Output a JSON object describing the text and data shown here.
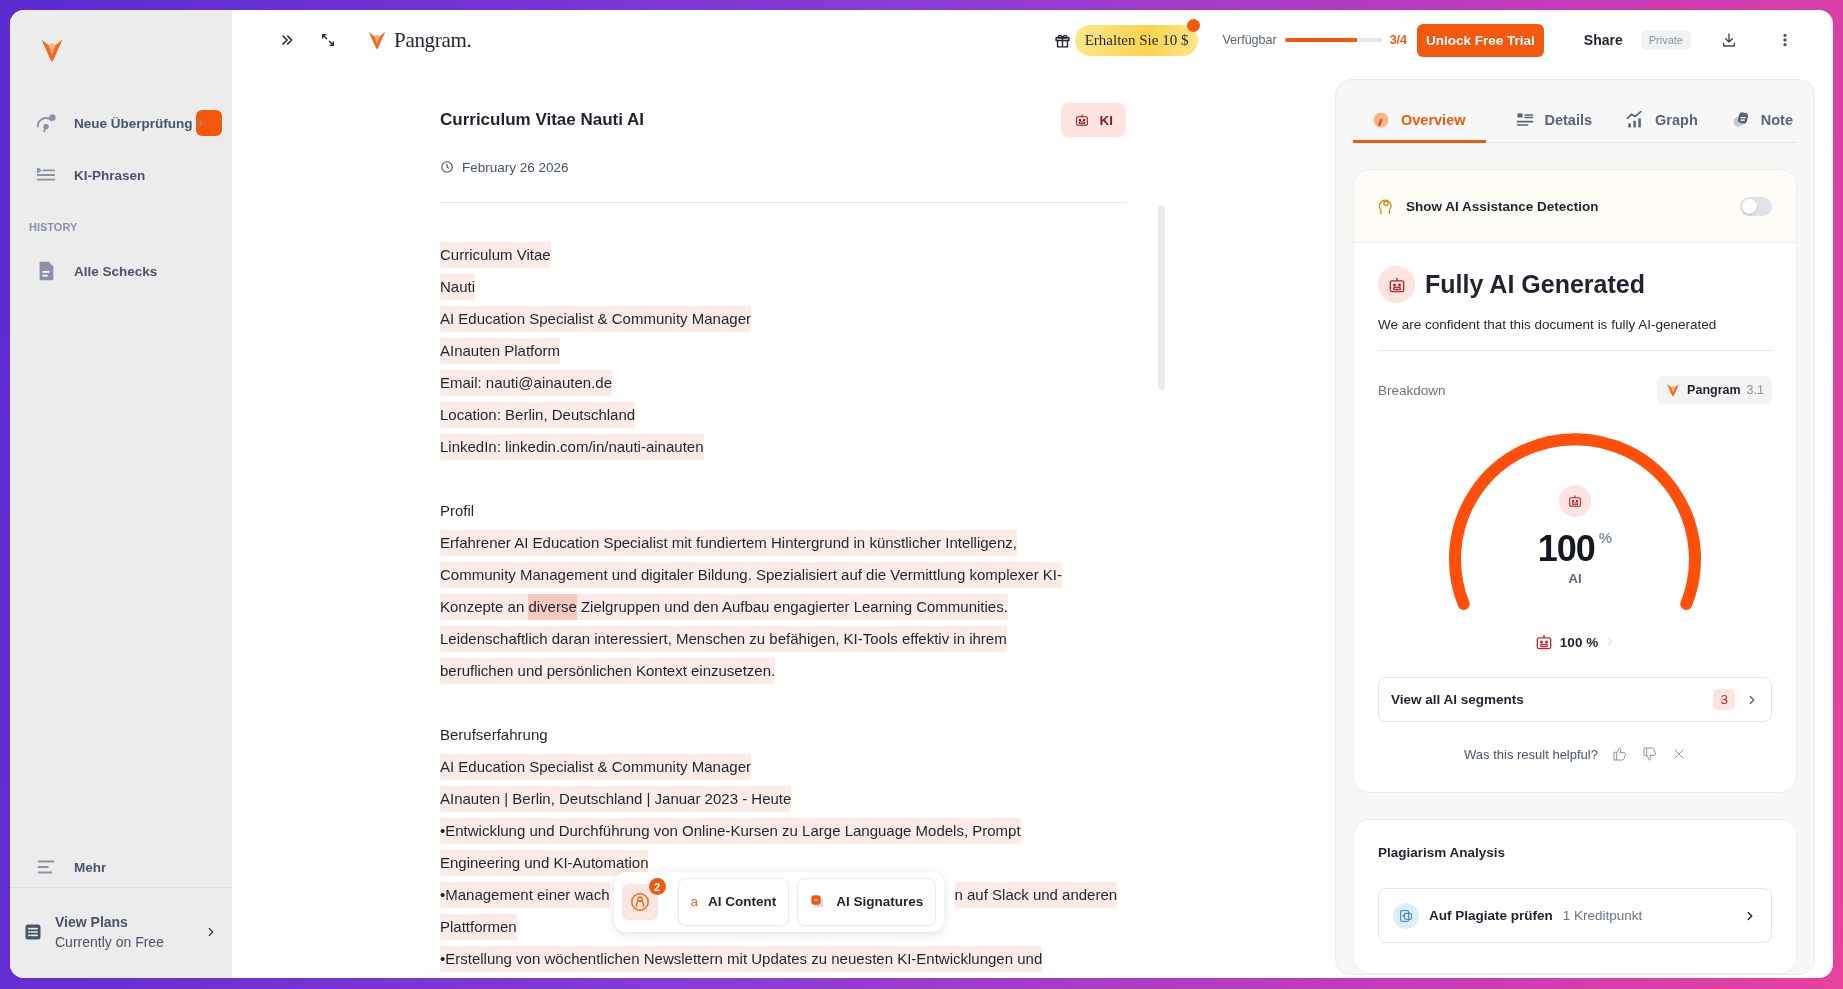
{
  "sidebar": {
    "items": [
      {
        "kind": "new",
        "label": "Neue Überprüfung"
      },
      {
        "kind": "phrases",
        "label": "KI-Phrasen"
      }
    ],
    "section_heading": "HISTORY",
    "history": [
      {
        "kind": "document",
        "label": "Alle Schecks"
      }
    ],
    "more": "Mehr",
    "plans": {
      "title": "View Plans",
      "subtitle": "Currently on Free"
    }
  },
  "topbar": {
    "brand": "Pangram.",
    "promo": {
      "label": "Erhalten Sie 10 $",
      "notification": true
    },
    "credits": {
      "label": "Verfügbar",
      "level": 0.75,
      "count": "3/4"
    },
    "upgrade_button": "Unlock Free Trial",
    "share_button": "Share",
    "visibility": "Private"
  },
  "document": {
    "title": "Curriculum Vitae Nauti AI",
    "badge": "KI",
    "date": "February 26 2026",
    "paragraphs": [
      {
        "lines": [
          {
            "kind": "text",
            "text": "Curriculum Vitae",
            "highlighted": true
          },
          {
            "kind": "text",
            "text": "Nauti",
            "highlighted": true
          },
          {
            "kind": "text",
            "text": "AI Education Specialist & Community Manager",
            "highlighted": true
          },
          {
            "kind": "text",
            "text": "AInauten Platform",
            "highlighted": true
          },
          {
            "kind": "text",
            "text": "Email: nauti@ainauten.de",
            "highlighted": true
          },
          {
            "kind": "text",
            "text": "Location: Berlin, Deutschland",
            "highlighted": true
          },
          {
            "kind": "text",
            "text": "LinkedIn: linkedin.com/in/nauti-ainauten",
            "highlighted": true
          }
        ]
      },
      {
        "lines": [
          {
            "kind": "text",
            "text": "Profil",
            "highlighted": false
          },
          {
            "kind": "text",
            "text": "Erfahrener AI Education Specialist mit fundiertem Hintergrund in künstlicher Intelligenz, ",
            "highlighted": true
          },
          {
            "kind": "text",
            "text": "Community Management und digitaler Bildung. Spezialisiert auf die Vermittlung komplexer KI-",
            "highlighted": true
          },
          {
            "kind": "mixed",
            "segments": [
              {
                "text": "Konzepte an ",
                "strong": false
              },
              {
                "text": "diverse",
                "strong": true
              },
              {
                "text": " Zielgruppen und den Aufbau engagierter Learning Communities.",
                "strong": false
              }
            ]
          },
          {
            "kind": "text",
            "text": "Leidenschaftlich daran interessiert, Menschen zu befähigen, KI-Tools effektiv in ihrem",
            "highlighted": true
          },
          {
            "kind": "text",
            "text": "beruflichen und persönlichen Kontext einzusetzen.",
            "highlighted": true
          }
        ]
      },
      {
        "lines": [
          {
            "kind": "text",
            "text": "Berufserfahrung",
            "highlighted": false
          },
          {
            "kind": "text",
            "text": "AI Education Specialist & Community Manager",
            "highlighted": true
          },
          {
            "kind": "text",
            "text": "AInauten | Berlin, Deutschland | Januar 2023 - Heute",
            "highlighted": true
          },
          {
            "kind": "text",
            "text": "•Entwicklung und Durchführung von Online-Kursen zu Large Language Models, Prompt",
            "highlighted": true
          },
          {
            "kind": "text",
            "text": "Engineering und KI-Automation",
            "highlighted": true
          },
          {
            "kind": "split",
            "text": "•Management einer wach",
            "after": "n auf Slack und anderen",
            "highlighted": true
          },
          {
            "kind": "text",
            "text": "Plattformen",
            "highlighted": true
          },
          {
            "kind": "text",
            "text": "•Erstellung von wöchentlichen Newslettern mit Updates zu neuesten KI-Entwicklungen und",
            "highlighted": true
          }
        ]
      }
    ]
  },
  "floating_toolbar": {
    "badge": "2",
    "chips": [
      {
        "kind": "content",
        "icon_letter": "a",
        "label": "AI Content"
      },
      {
        "kind": "signatures",
        "label": "AI Signatures"
      }
    ]
  },
  "panel": {
    "tabs": [
      {
        "kind": "overview",
        "label": "Overview",
        "selected": true
      },
      {
        "kind": "details",
        "label": "Details",
        "selected": false
      },
      {
        "kind": "graph",
        "label": "Graph",
        "selected": false
      },
      {
        "kind": "note",
        "label": "Note",
        "selected": false
      }
    ],
    "assistance": {
      "label": "Show AI Assistance Detection",
      "on": false
    },
    "verdict": {
      "title": "Fully AI Generated",
      "description": "We are confident that this document is fully AI-generated"
    },
    "breakdown": {
      "label": "Breakdown",
      "model": "Pangram",
      "version": "3.1"
    },
    "gauge": {
      "level": 1,
      "value": "100",
      "unit": "%",
      "caption": "AI"
    },
    "ai_share": "100 %",
    "segments_button": {
      "label": "View all AI segments",
      "count": "3"
    },
    "feedback": "Was this result helpful?",
    "plagiarism": {
      "title": "Plagiarism Analysis",
      "action": "Auf Plagiate prüfen",
      "cost": "1 Kreditpunkt"
    }
  }
}
